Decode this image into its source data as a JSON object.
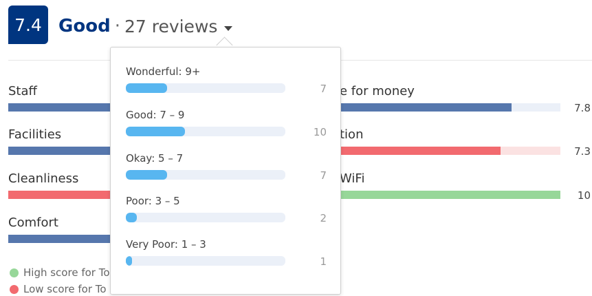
{
  "header": {
    "score": "7.4",
    "rating_word": "Good",
    "separator": "·",
    "review_count": "27 reviews"
  },
  "categories_left": [
    {
      "label": "Staff",
      "color": "#5677ad"
    },
    {
      "label": "Facilities",
      "color": "#5677ad"
    },
    {
      "label": "Cleanliness",
      "color": "#f26a6f"
    },
    {
      "label": "Comfort",
      "color": "#5677ad"
    }
  ],
  "categories_right": [
    {
      "label_visible": "e for money",
      "value": "7.8",
      "fill_fraction": 0.78,
      "color": "#5677ad"
    },
    {
      "label_visible": "tion",
      "value": "7.3",
      "fill_fraction": 0.73,
      "color": "#f26a6f"
    },
    {
      "label_visible": "WiFi",
      "value": "10",
      "fill_fraction": 1.0,
      "color": "#97d799"
    }
  ],
  "legend": {
    "high": "High score for To",
    "low": "Low score for To",
    "high_color": "#97d799",
    "low_color": "#f26a6f"
  },
  "dropdown": {
    "items": [
      {
        "label": "Wonderful: 9+",
        "count": "7",
        "fraction": 0.26
      },
      {
        "label": "Good: 7 – 9",
        "count": "10",
        "fraction": 0.37
      },
      {
        "label": "Okay: 5 – 7",
        "count": "7",
        "fraction": 0.26
      },
      {
        "label": "Poor: 3 – 5",
        "count": "2",
        "fraction": 0.07
      },
      {
        "label": "Very Poor: 1 – 3",
        "count": "1",
        "fraction": 0.04
      }
    ],
    "bar_color": "#58b6f0"
  }
}
